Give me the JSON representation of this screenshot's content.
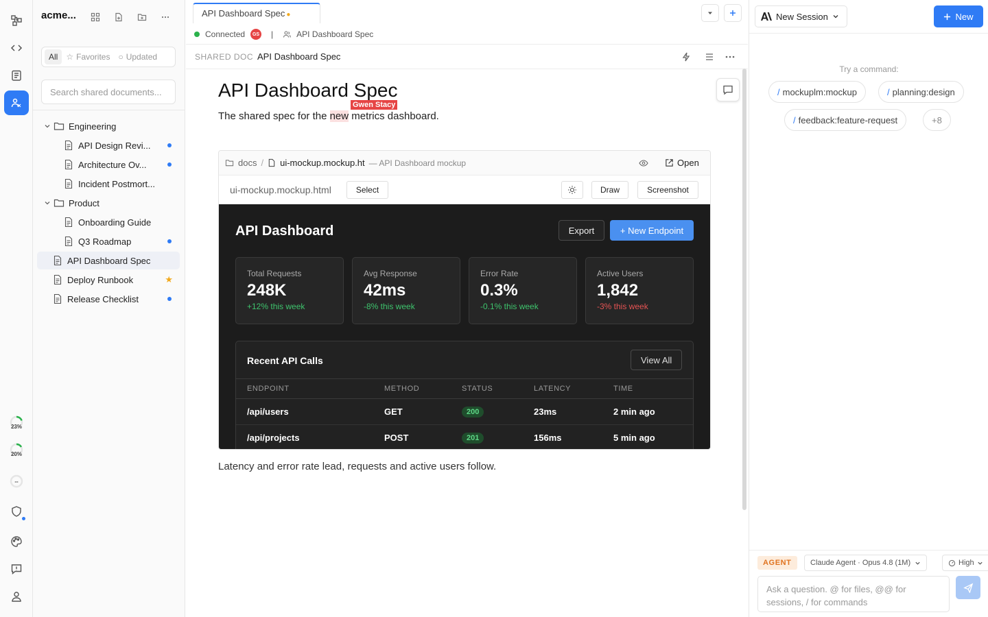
{
  "workspace": {
    "title": "acme..."
  },
  "rail": {
    "usage_1": "23%",
    "usage_2": "20%",
    "usage_3": "--"
  },
  "sidebar": {
    "filters": {
      "all": "All",
      "favorites": "Favorites",
      "updated": "Updated"
    },
    "search_placeholder": "Search shared documents...",
    "tree": [
      {
        "label": "Engineering",
        "type": "folder"
      },
      {
        "label": "API Design Revi...",
        "type": "doc",
        "unread": true
      },
      {
        "label": "Architecture Ov...",
        "type": "doc",
        "unread": true
      },
      {
        "label": "Incident Postmort...",
        "type": "doc"
      },
      {
        "label": "Product",
        "type": "folder"
      },
      {
        "label": "Onboarding Guide",
        "type": "doc"
      },
      {
        "label": "Q3 Roadmap",
        "type": "doc",
        "unread": true
      },
      {
        "label": "API Dashboard Spec",
        "type": "doc",
        "selected": true
      },
      {
        "label": "Deploy Runbook",
        "type": "doc",
        "favorite": true
      },
      {
        "label": "Release Checklist",
        "type": "doc",
        "unread": true
      }
    ]
  },
  "editor": {
    "tab_title": "API Dashboard Spec",
    "tab_modified": "●",
    "status": {
      "connection": "Connected",
      "avatar": "GS",
      "separator": "|",
      "doc": "API Dashboard Spec"
    },
    "doc_bar": {
      "kicker": "SHARED DOC",
      "title": "API Dashboard Spec"
    },
    "heading": "API Dashboard Spec",
    "collab_cursor": "Gwen Stacy",
    "para_before": "The shared spec for the ",
    "para_highlight": "new",
    "para_after": " metrics dashboard.",
    "closing_para": "Latency and error rate lead, requests and active users follow."
  },
  "embed": {
    "crumb_folder": "docs",
    "crumb_sep": "/",
    "file": "ui-mockup.mockup.ht",
    "file_desc": "— API Dashboard mockup",
    "open": "Open",
    "filename": "ui-mockup.mockup.html",
    "select": "Select",
    "draw": "Draw",
    "screenshot": "Screenshot"
  },
  "mockup": {
    "title": "API Dashboard",
    "export": "Export",
    "new_endpoint": "+ New Endpoint",
    "stats": [
      {
        "label": "Total Requests",
        "value": "248K",
        "delta": "+12% this week",
        "trend": "up"
      },
      {
        "label": "Avg Response",
        "value": "42ms",
        "delta": "-8% this week",
        "trend": "up"
      },
      {
        "label": "Error Rate",
        "value": "0.3%",
        "delta": "-0.1% this week",
        "trend": "up"
      },
      {
        "label": "Active Users",
        "value": "1,842",
        "delta": "-3% this week",
        "trend": "down"
      }
    ],
    "calls_title": "Recent API Calls",
    "view_all": "View All",
    "columns": [
      "ENDPOINT",
      "METHOD",
      "STATUS",
      "LATENCY",
      "TIME"
    ],
    "rows": [
      {
        "endpoint": "/api/users",
        "method": "GET",
        "status": "200",
        "latency": "23ms",
        "time": "2 min ago"
      },
      {
        "endpoint": "/api/projects",
        "method": "POST",
        "status": "201",
        "latency": "156ms",
        "time": "5 min ago"
      }
    ]
  },
  "right": {
    "session": "New Session",
    "new": "New",
    "try": "Try a command:",
    "commands": [
      "mockuplm:mockup",
      "planning:design",
      "feedback:feature-request"
    ],
    "more": "+8",
    "slash": "/",
    "agent": "AGENT",
    "model": "Claude Agent · Opus 4.8 (1M)",
    "effort": "High",
    "ask_placeholder": "Ask a question. @ for files, @@ for sessions, / for commands"
  },
  "colors": {
    "accent": "#2f7bf5",
    "collab": "#e64545",
    "positive": "#3ec46d",
    "negative": "#e55353",
    "dark_bg": "#1c1c1c"
  }
}
